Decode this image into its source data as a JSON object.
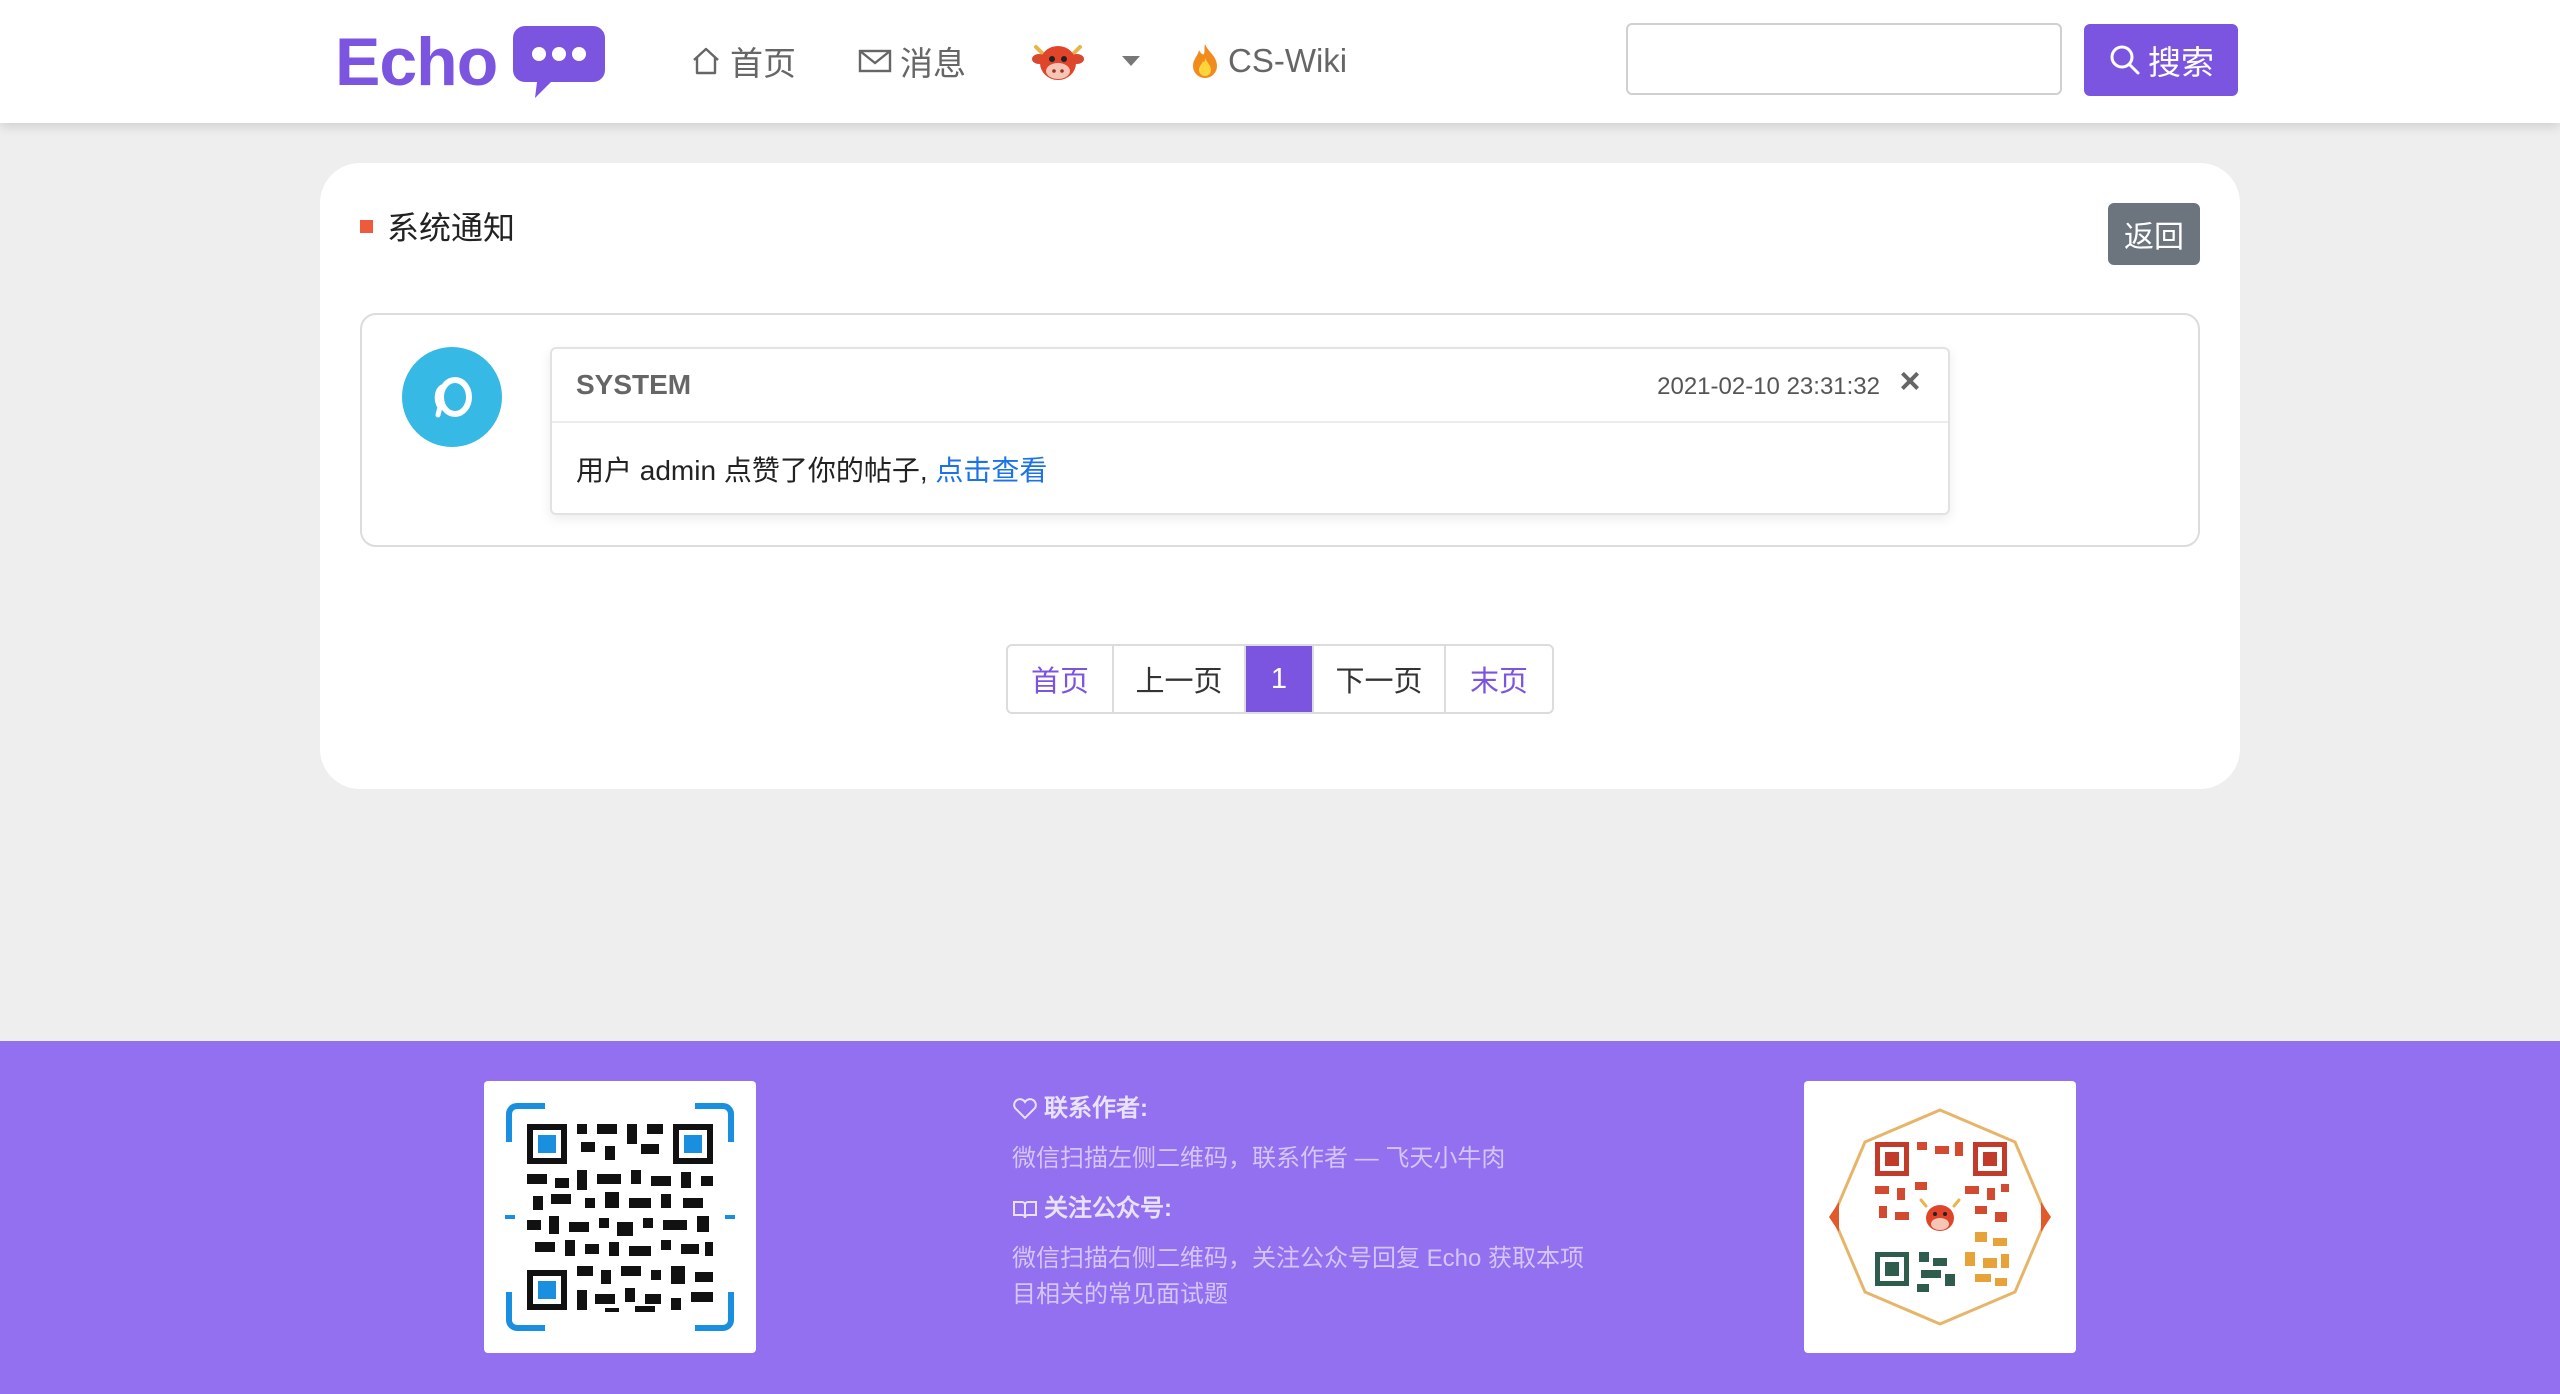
{
  "header": {
    "logo": "Echo",
    "nav": {
      "home": "首页",
      "messages": "消息",
      "wiki": "CS-Wiki"
    },
    "search": {
      "value": "",
      "placeholder": "",
      "button": "搜索"
    }
  },
  "main": {
    "section_title": "系统通知",
    "back_button": "返回",
    "notice": {
      "sender": "SYSTEM",
      "time": "2021-02-10 23:31:32",
      "close": "×",
      "message_prefix": "用户 admin 点赞了你的帖子,",
      "link_text": "点击查看"
    },
    "pagination": {
      "first": "首页",
      "prev": "上一页",
      "current": "1",
      "next": "下一页",
      "last": "末页"
    }
  },
  "footer": {
    "contact_title": "联系作者:",
    "contact_text": "微信扫描左侧二维码，联系作者 — 飞天小牛肉",
    "follow_title": "关注公众号:",
    "follow_text": "微信扫描右侧二维码，关注公众号回复 Echo 获取本项目相关的常见面试题"
  },
  "colors": {
    "brand": "#7b55e0",
    "footer_bg": "#9370f0",
    "avatar_bg": "#36b9e5",
    "back_button": "#6c757d",
    "section_marker": "#f05a3c",
    "link": "#1a73e8"
  },
  "icons": [
    "chat-bubble-icon",
    "home-icon",
    "mail-icon",
    "cow-avatar-icon",
    "flame-icon",
    "search-icon",
    "close-icon",
    "heart-icon",
    "book-icon",
    "qr-code"
  ]
}
